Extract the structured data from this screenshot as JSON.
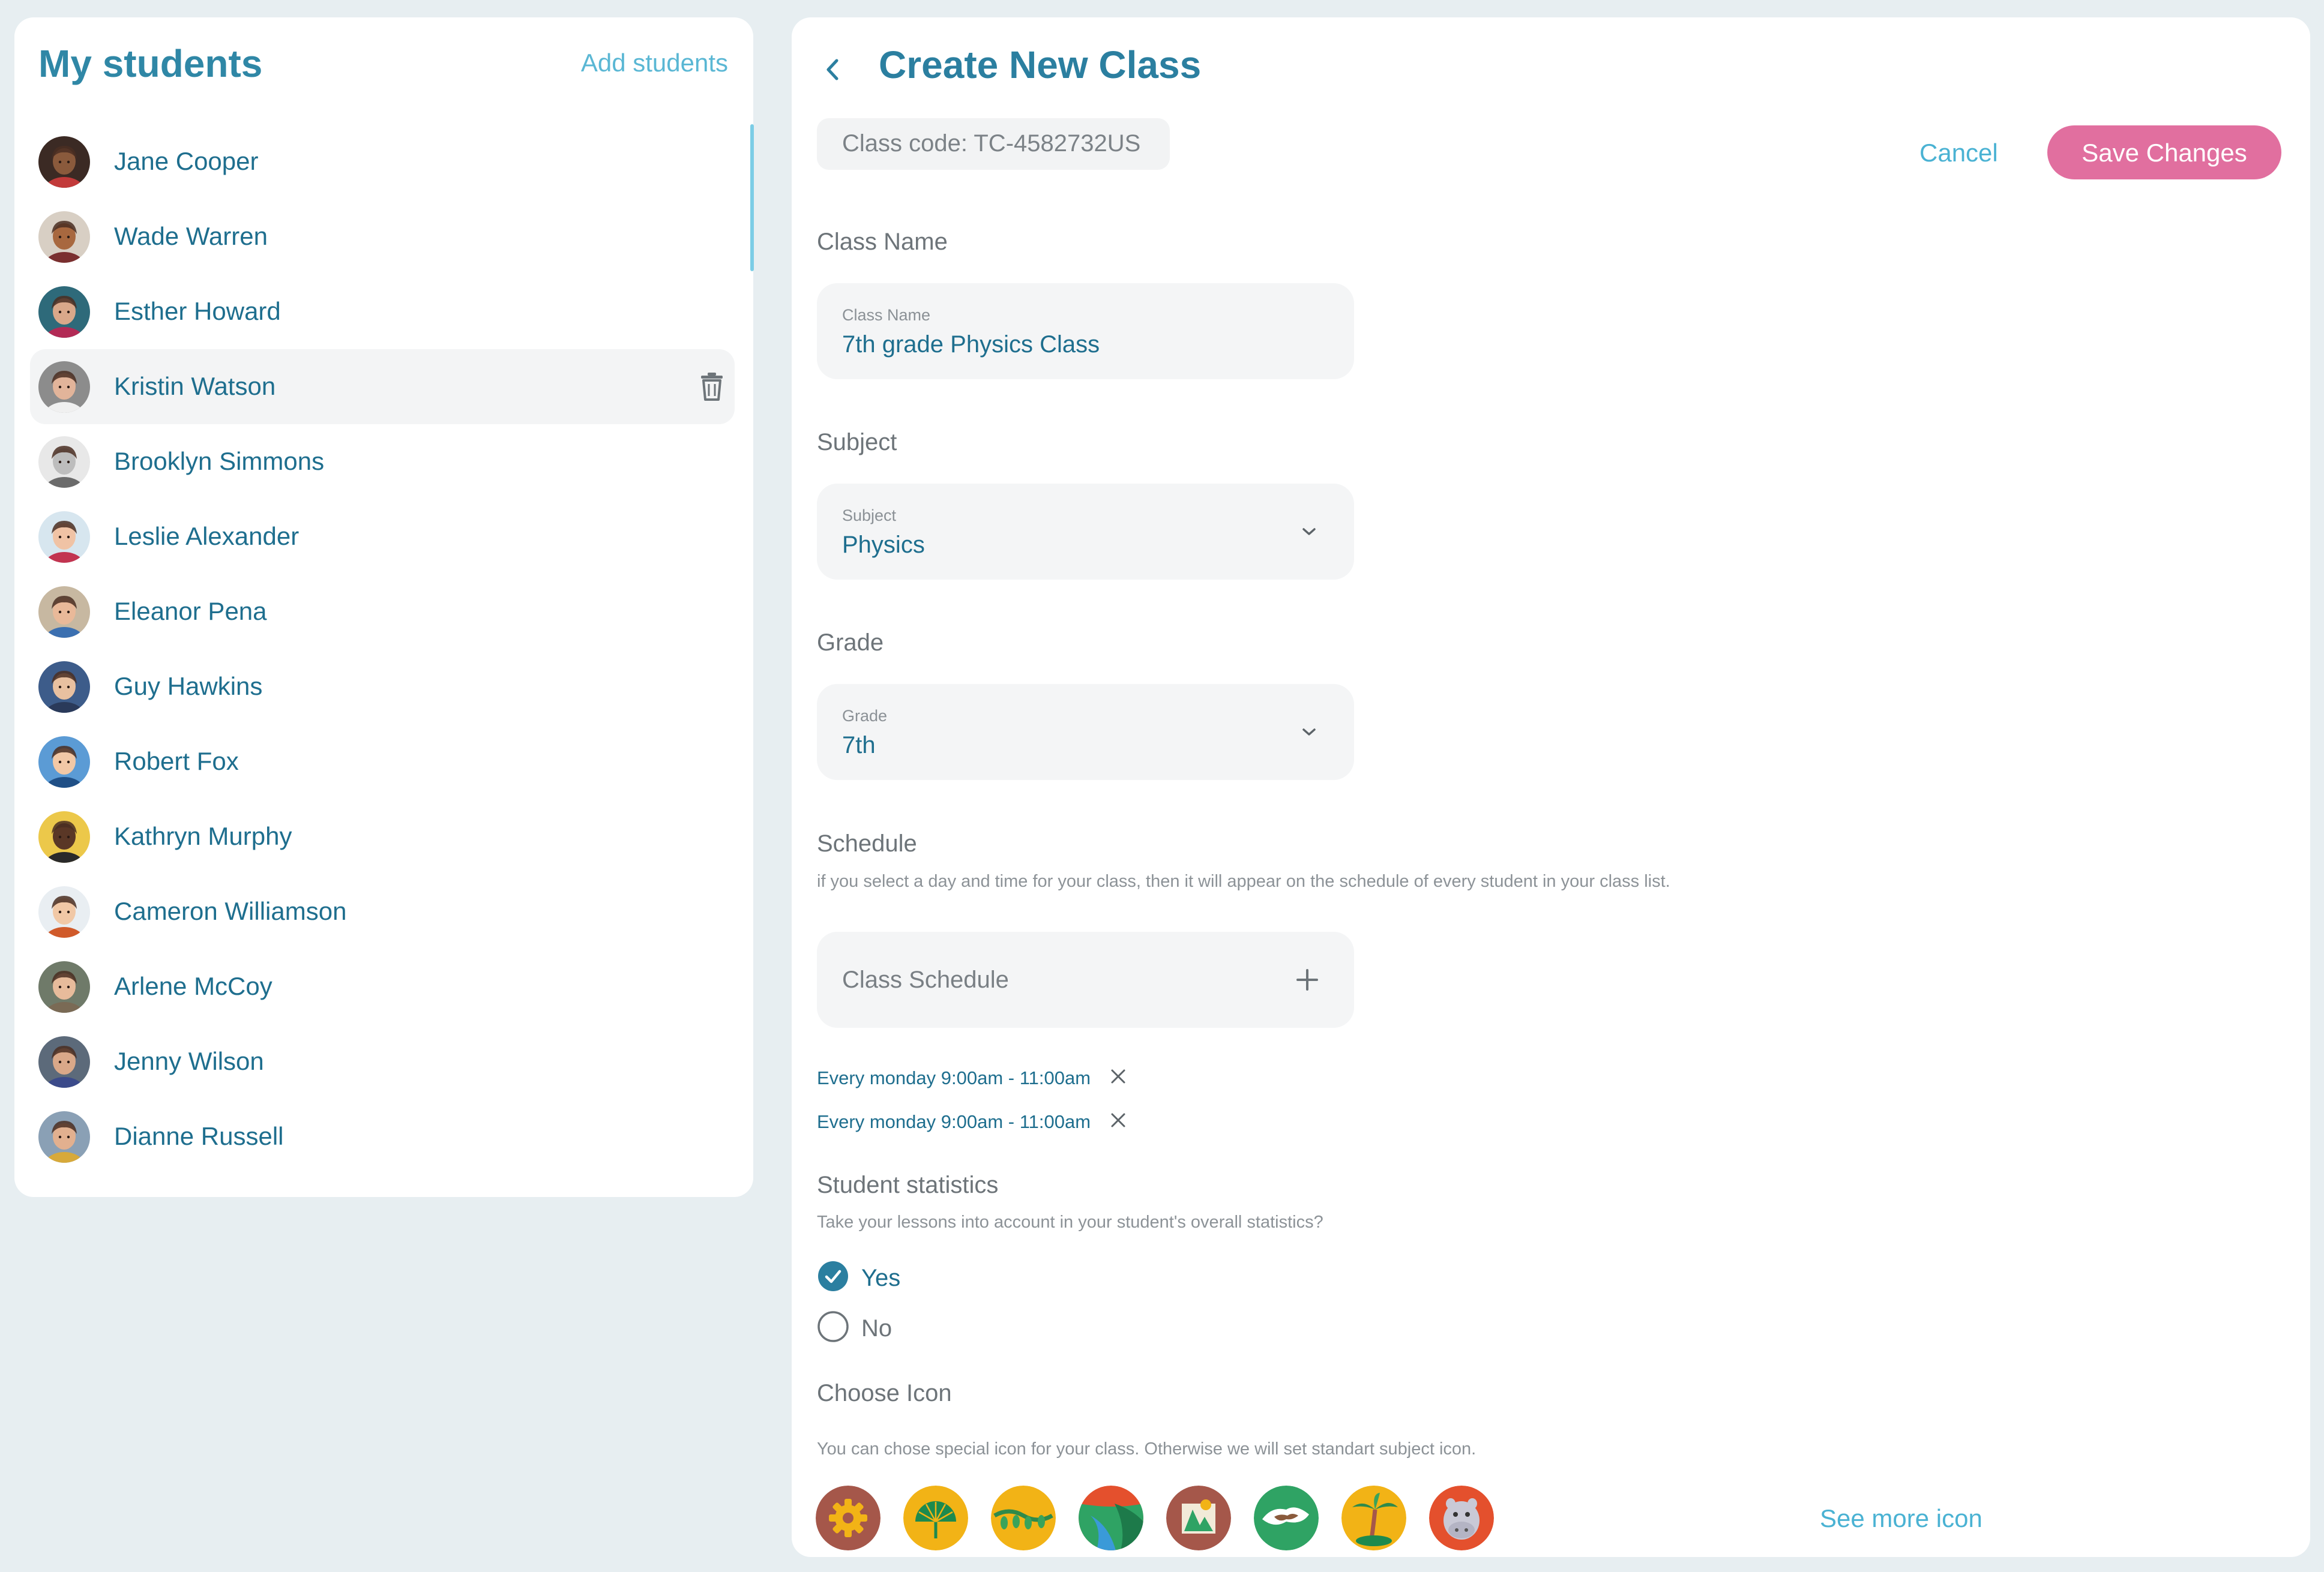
{
  "students_panel": {
    "title": "My students",
    "add_label": "Add students",
    "students": [
      {
        "name": "Jane Cooper",
        "bg": "#3b2a24",
        "skin": "#8a5a3c",
        "shirt": "#c23a3a"
      },
      {
        "name": "Wade Warren",
        "bg": "#d8cfc4",
        "skin": "#a8683f",
        "shirt": "#7a2f2f"
      },
      {
        "name": "Esther Howard",
        "bg": "#2e6a7a",
        "skin": "#d9a88a",
        "shirt": "#b22a55"
      },
      {
        "name": "Kristin Watson",
        "bg": "#8c8c8c",
        "skin": "#e2b49a",
        "shirt": "#f0f0f0"
      },
      {
        "name": "Brooklyn Simmons",
        "bg": "#e8e8e8",
        "skin": "#bdbdbd",
        "shirt": "#6b6b6b"
      },
      {
        "name": "Leslie Alexander",
        "bg": "#d7e6ef",
        "skin": "#f0c3a5",
        "shirt": "#c23450"
      },
      {
        "name": "Eleanor Pena",
        "bg": "#c7b8a1",
        "skin": "#e9b999",
        "shirt": "#3b6fb0"
      },
      {
        "name": "Guy Hawkins",
        "bg": "#3d5c8a",
        "skin": "#e8c0a0",
        "shirt": "#2a3a5a"
      },
      {
        "name": "Robert Fox",
        "bg": "#5b9bd5",
        "skin": "#f2c8a6",
        "shirt": "#1f4f86"
      },
      {
        "name": "Kathryn Murphy",
        "bg": "#ecc84a",
        "skin": "#5a3726",
        "shirt": "#2a2a2a"
      },
      {
        "name": "Cameron Williamson",
        "bg": "#e9eef2",
        "skin": "#f1c8a6",
        "shirt": "#d05a2a"
      },
      {
        "name": "Arlene McCoy",
        "bg": "#6f7a69",
        "skin": "#e7bb9b",
        "shirt": "#7a6a55"
      },
      {
        "name": "Jenny Wilson",
        "bg": "#5c6a7a",
        "skin": "#d9a889",
        "shirt": "#3b4a8a"
      },
      {
        "name": "Dianne Russell",
        "bg": "#8aa0b5",
        "skin": "#e2b08f",
        "shirt": "#d7a93a"
      }
    ],
    "selected_index": 3
  },
  "form": {
    "title": "Create New Class",
    "class_code": "Class code: TC-4582732US",
    "cancel_label": "Cancel",
    "save_label": "Save Changes",
    "class_name": {
      "section": "Class Name",
      "label": "Class Name",
      "value": "7th grade Physics Class"
    },
    "subject": {
      "section": "Subject",
      "label": "Subject",
      "value": "Physics"
    },
    "grade": {
      "section": "Grade",
      "label": "Grade",
      "value": "7th"
    },
    "schedule": {
      "section": "Schedule",
      "description": "if you select a day and time for your class, then it will appear on the schedule of every student in your class list.",
      "placeholder": "Class Schedule",
      "items": [
        "Every monday 9:00am - 11:00am",
        "Every monday 9:00am - 11:00am"
      ]
    },
    "statistics": {
      "section": "Student statistics",
      "description": "Take your lessons into account in your student's overall statistics?",
      "options": [
        {
          "label": "Yes",
          "checked": true
        },
        {
          "label": "No",
          "checked": false
        }
      ]
    },
    "icon_choice": {
      "section": "Choose Icon",
      "description": "You can chose special icon for your class. Otherwise we will set standart subject icon.",
      "icons": [
        {
          "name": "gear-icon",
          "bg": "#a5574a"
        },
        {
          "name": "palm-leaf-icon",
          "bg": "#f2b316"
        },
        {
          "name": "vine-icon",
          "bg": "#f2b316"
        },
        {
          "name": "river-icon",
          "bg": "#e4502d"
        },
        {
          "name": "map-icon",
          "bg": "#a5574a"
        },
        {
          "name": "globe-icon",
          "bg": "#2fa364"
        },
        {
          "name": "palm-tree-icon",
          "bg": "#f2b316"
        },
        {
          "name": "hippo-icon",
          "bg": "#e4502d"
        }
      ],
      "see_more": "See more icon"
    }
  },
  "colors": {
    "accent": "#2b7fa0",
    "link": "#4ab2d3",
    "primary_button": "#e16f9f",
    "page_background": "#e7eef1"
  }
}
